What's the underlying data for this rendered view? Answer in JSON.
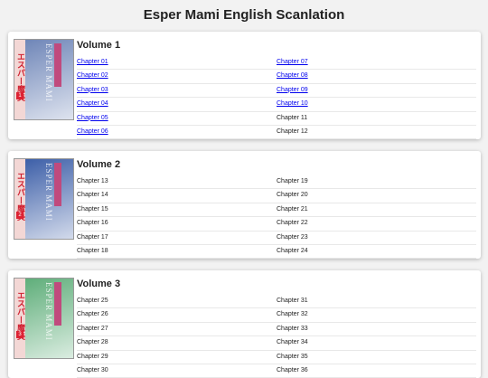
{
  "page": {
    "title": "Esper Mami English Scanlation"
  },
  "volumes": [
    {
      "title": "Volume 1",
      "number": "1",
      "cover_colors": {
        "spine": "#f3d7d5",
        "art": "#6f86b8",
        "band": "#c04a7d"
      },
      "chapters": [
        {
          "label": "Chapter 01",
          "link": true
        },
        {
          "label": "Chapter 07",
          "link": true
        },
        {
          "label": "Chapter 02",
          "link": true
        },
        {
          "label": "Chapter 08",
          "link": true
        },
        {
          "label": "Chapter 03",
          "link": true
        },
        {
          "label": "Chapter 09",
          "link": true
        },
        {
          "label": "Chapter 04",
          "link": true
        },
        {
          "label": "Chapter 10",
          "link": true
        },
        {
          "label": "Chapter 05",
          "link": true
        },
        {
          "label": "Chapter 11",
          "link": false
        },
        {
          "label": "Chapter 06",
          "link": true
        },
        {
          "label": "Chapter 12",
          "link": false
        }
      ]
    },
    {
      "title": "Volume 2",
      "number": "2",
      "cover_colors": {
        "spine": "#f3d7d5",
        "art": "#3d5fa8",
        "band": "#c04a7d"
      },
      "chapters": [
        {
          "label": "Chapter 13",
          "link": false
        },
        {
          "label": "Chapter 19",
          "link": false
        },
        {
          "label": "Chapter 14",
          "link": false
        },
        {
          "label": "Chapter 20",
          "link": false
        },
        {
          "label": "Chapter 15",
          "link": false
        },
        {
          "label": "Chapter 21",
          "link": false
        },
        {
          "label": "Chapter 16",
          "link": false
        },
        {
          "label": "Chapter 22",
          "link": false
        },
        {
          "label": "Chapter 17",
          "link": false
        },
        {
          "label": "Chapter 23",
          "link": false
        },
        {
          "label": "Chapter 18",
          "link": false
        },
        {
          "label": "Chapter 24",
          "link": false
        }
      ]
    },
    {
      "title": "Volume 3",
      "number": "3",
      "cover_colors": {
        "spine": "#f3d7d5",
        "art": "#5fae7a",
        "band": "#c04a7d"
      },
      "chapters": [
        {
          "label": "Chapter 25",
          "link": false
        },
        {
          "label": "Chapter 31",
          "link": false
        },
        {
          "label": "Chapter 26",
          "link": false
        },
        {
          "label": "Chapter 32",
          "link": false
        },
        {
          "label": "Chapter 27",
          "link": false
        },
        {
          "label": "Chapter 33",
          "link": false
        },
        {
          "label": "Chapter 28",
          "link": false
        },
        {
          "label": "Chapter 34",
          "link": false
        },
        {
          "label": "Chapter 29",
          "link": false
        },
        {
          "label": "Chapter 35",
          "link": false
        },
        {
          "label": "Chapter 30",
          "link": false
        },
        {
          "label": "Chapter 36",
          "link": false
        }
      ]
    }
  ]
}
